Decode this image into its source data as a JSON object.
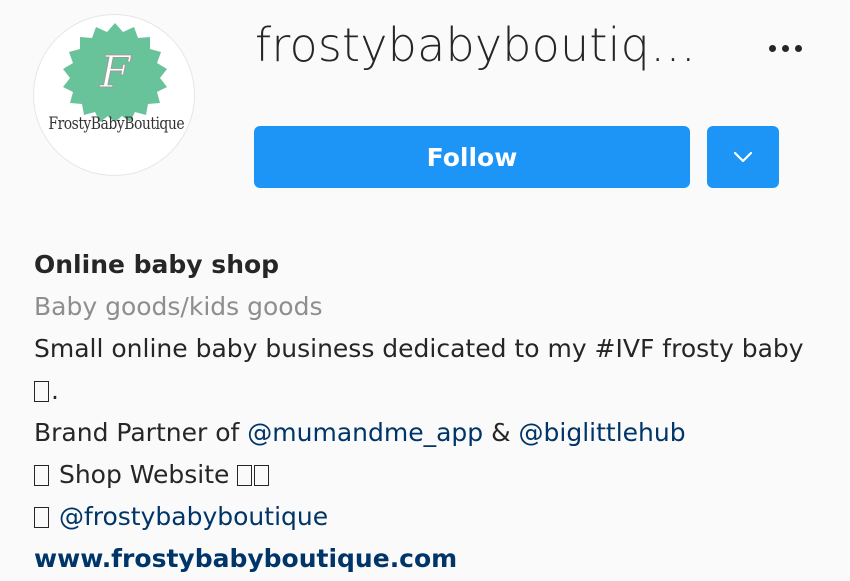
{
  "profile": {
    "username": "frostybabyboutiq…",
    "avatar_text": "FrostyBabyBoutique",
    "avatar_letter": "F",
    "colors": {
      "follow_blue": "#1c95f6",
      "avatar_green": "#69c39a",
      "text_dark": "#262626",
      "text_muted": "#8e8e8e",
      "link_blue": "#003569"
    }
  },
  "actions": {
    "follow_label": "Follow",
    "dropdown_icon": "chevron-down-icon",
    "more_icon": "more-options-icon"
  },
  "bio": {
    "name": "Online baby shop",
    "category": "Baby goods/kids goods",
    "line1": "Small online baby business dedicated to my #IVF frosty baby",
    "line2_suffix": ".",
    "line3_prefix": "Brand Partner of ",
    "mention1": "@mumandme_app",
    "line3_join": " & ",
    "mention2": "@biglittlehub",
    "line4_text": " Shop Website ",
    "line5_mention": "@frostybabyboutique",
    "website": "www.frostybabyboutique.com"
  }
}
